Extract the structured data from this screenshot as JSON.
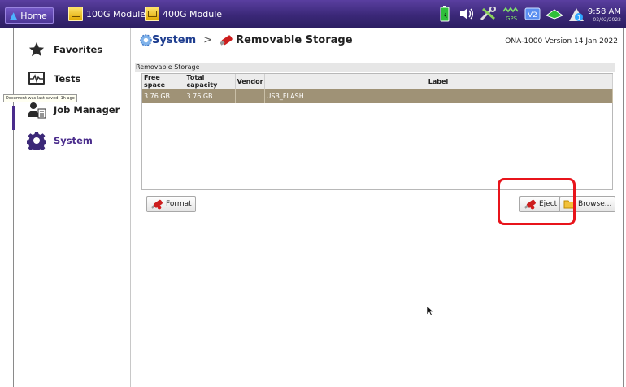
{
  "topbar": {
    "home_label": "Home",
    "tabs": [
      {
        "label": "100G Module",
        "icon": "bert-module-icon"
      },
      {
        "label": "400G Module",
        "icon": "bert-module-icon"
      }
    ],
    "status_icons": [
      "battery-charging-icon",
      "speaker-icon",
      "tools-icon",
      "gps-icon",
      "v2-icon",
      "network-icon",
      "upload-icon"
    ],
    "gps_label": "GPS",
    "v2_label": "V2",
    "upload_badge": "1",
    "time": "9:58 AM",
    "date": "03/02/2022",
    "accent": "#3b2878"
  },
  "sidebar": {
    "items": [
      {
        "label": "Favorites",
        "icon": "star-icon"
      },
      {
        "label": "Tests",
        "icon": "tests-icon"
      },
      {
        "label": "Job Manager",
        "icon": "job-manager-icon"
      },
      {
        "label": "System",
        "icon": "gear-icon",
        "active": true
      }
    ],
    "tooltip": "Document was last saved: 1h ago"
  },
  "breadcrumb": {
    "root": "System",
    "separator": ">",
    "current": "Removable Storage"
  },
  "version": "ONA-1000 Version 14 Jan 2022",
  "storage": {
    "panel_title": "Removable Storage",
    "columns": [
      "Free space",
      "Total capacity",
      "Vendor",
      "Label"
    ],
    "rows": [
      {
        "free": "3.76 GB",
        "total": "3.76 GB",
        "vendor": "",
        "label": "USB_FLASH"
      }
    ],
    "selected_row_color": "#9f9276"
  },
  "buttons": {
    "format": "Format",
    "eject": "Eject",
    "browse": "Browse..."
  },
  "highlight_color": "#e8141b"
}
